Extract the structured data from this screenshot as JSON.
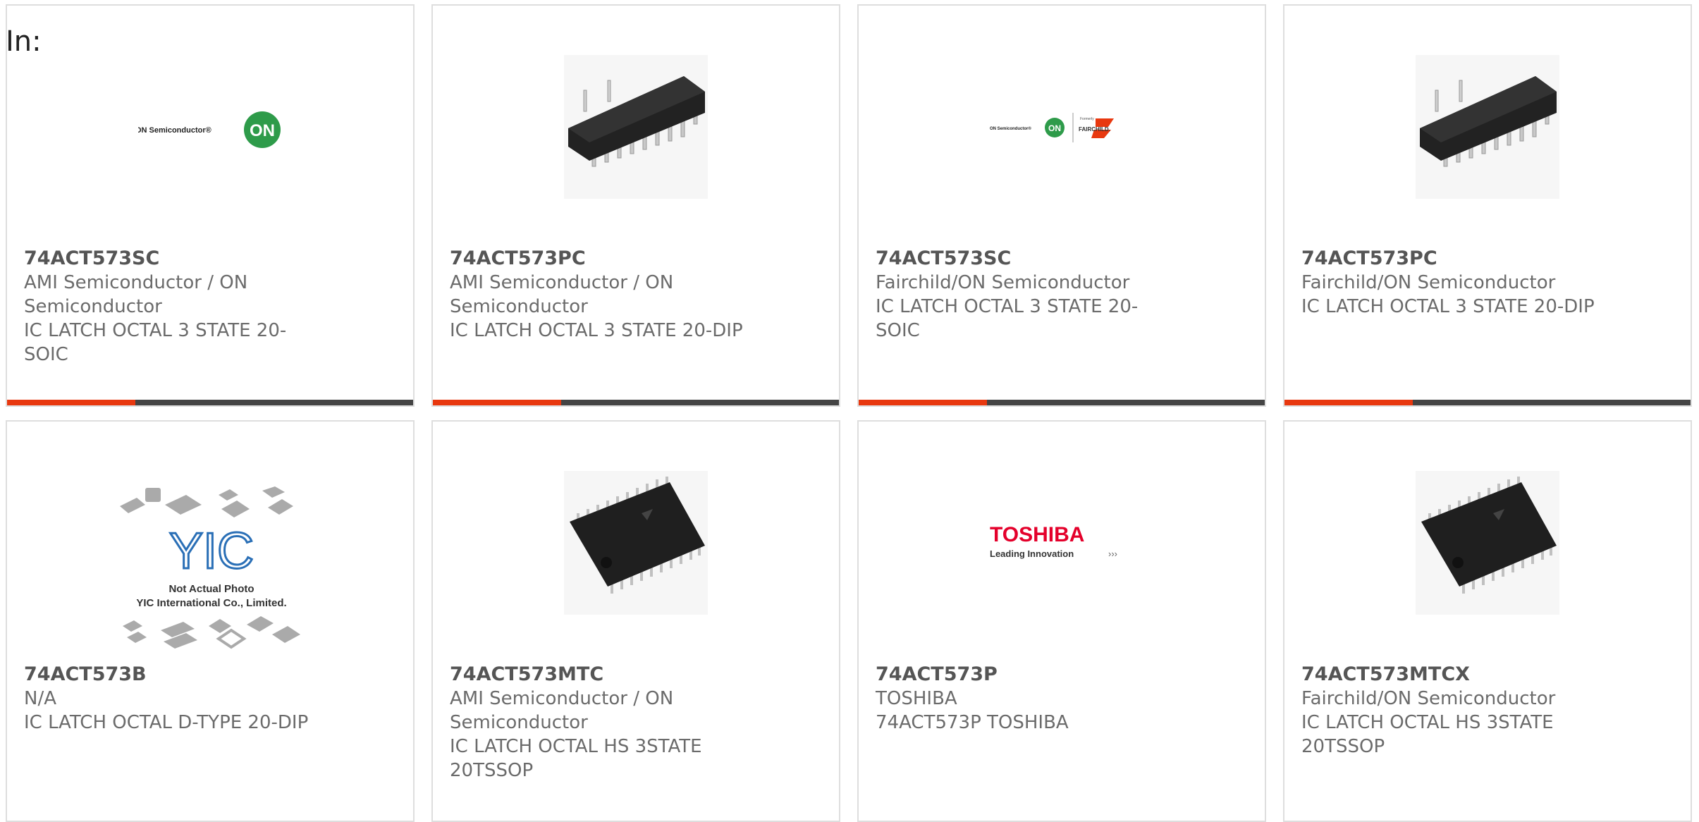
{
  "header": {
    "label": "In:"
  },
  "colors": {
    "accent": "#e8380f",
    "bar": "#444444",
    "border": "#dedede"
  },
  "products": [
    {
      "part": "74ACT573SC",
      "manufacturer": "AMI Semiconductor / ON Semiconductor",
      "description": "IC LATCH OCTAL 3 STATE 20-SOIC",
      "image": "on-semiconductor-logo",
      "logo_text": "ON Semiconductor®",
      "logo_badge": "ON"
    },
    {
      "part": "74ACT573PC",
      "manufacturer": "AMI Semiconductor / ON Semiconductor",
      "description": "IC LATCH OCTAL 3 STATE 20-DIP",
      "image": "dip-chip-photo"
    },
    {
      "part": "74ACT573SC",
      "manufacturer": "Fairchild/ON Semiconductor",
      "description": "IC LATCH OCTAL 3 STATE 20-SOIC",
      "image": "on-fairchild-logo",
      "logo_text": "ON Semiconductor®",
      "logo_badge": "ON",
      "logo_formerly": "Formerly",
      "logo_fairchild": "FAIRCHILD."
    },
    {
      "part": "74ACT573PC",
      "manufacturer": "Fairchild/ON Semiconductor",
      "description": "IC LATCH OCTAL 3 STATE 20-DIP",
      "image": "dip-chip-photo"
    },
    {
      "part": "74ACT573B",
      "manufacturer": "N/A",
      "description": "IC LATCH OCTAL D-TYPE 20-DIP",
      "image": "yic-placeholder",
      "yic_logo": "YIC",
      "yic_line1": "Not Actual Photo",
      "yic_line2": "YIC International Co., Limited."
    },
    {
      "part": "74ACT573MTC",
      "manufacturer": "AMI Semiconductor / ON Semiconductor",
      "description": "IC LATCH OCTAL HS 3STATE 20TSSOP",
      "image": "tssop-chip-photo"
    },
    {
      "part": "74ACT573P",
      "manufacturer": "TOSHIBA",
      "description": "74ACT573P TOSHIBA",
      "image": "toshiba-logo",
      "logo_text": "TOSHIBA",
      "logo_tagline": "Leading Innovation"
    },
    {
      "part": "74ACT573MTCX",
      "manufacturer": "Fairchild/ON Semiconductor",
      "description": "IC LATCH OCTAL HS 3STATE 20TSSOP",
      "image": "tssop-chip-photo"
    }
  ]
}
